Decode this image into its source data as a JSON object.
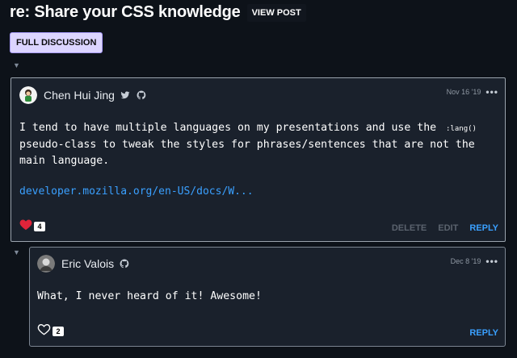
{
  "header": {
    "title": "re: Share your CSS knowledge",
    "view_post_label": "VIEW POST"
  },
  "full_discussion_label": "FULL DISCUSSION",
  "comments": [
    {
      "author": "Chen Hui Jing",
      "date": "Nov 16 '19",
      "menu_glyph": "•••",
      "body_line1": "I tend to have multiple languages on my presentations and use the ",
      "inline_code": ":lang()",
      "body_line2": "pseudo-class to tweak the styles for phrases/sentences that are not the",
      "body_line3": "main language.",
      "link": "developer.mozilla.org/en-US/docs/W...",
      "reaction_count": "4",
      "actions": {
        "delete": "DELETE",
        "edit": "EDIT",
        "reply": "REPLY"
      },
      "icons": [
        "heart-filled-icon",
        "twitter-icon",
        "github-icon"
      ]
    },
    {
      "author": "Eric Valois",
      "date": "Dec 8 '19",
      "menu_glyph": "•••",
      "body": "What, I never heard of it! Awesome!",
      "reaction_count": "2",
      "actions": {
        "reply": "REPLY"
      },
      "icons": [
        "heart-outline-icon",
        "github-icon"
      ]
    }
  ],
  "colors": {
    "background": "#0d1219",
    "card": "#1a212c",
    "link": "#3aa0ff",
    "heart": "#e0243a",
    "full_discussion_bg": "#dcd5ff"
  }
}
